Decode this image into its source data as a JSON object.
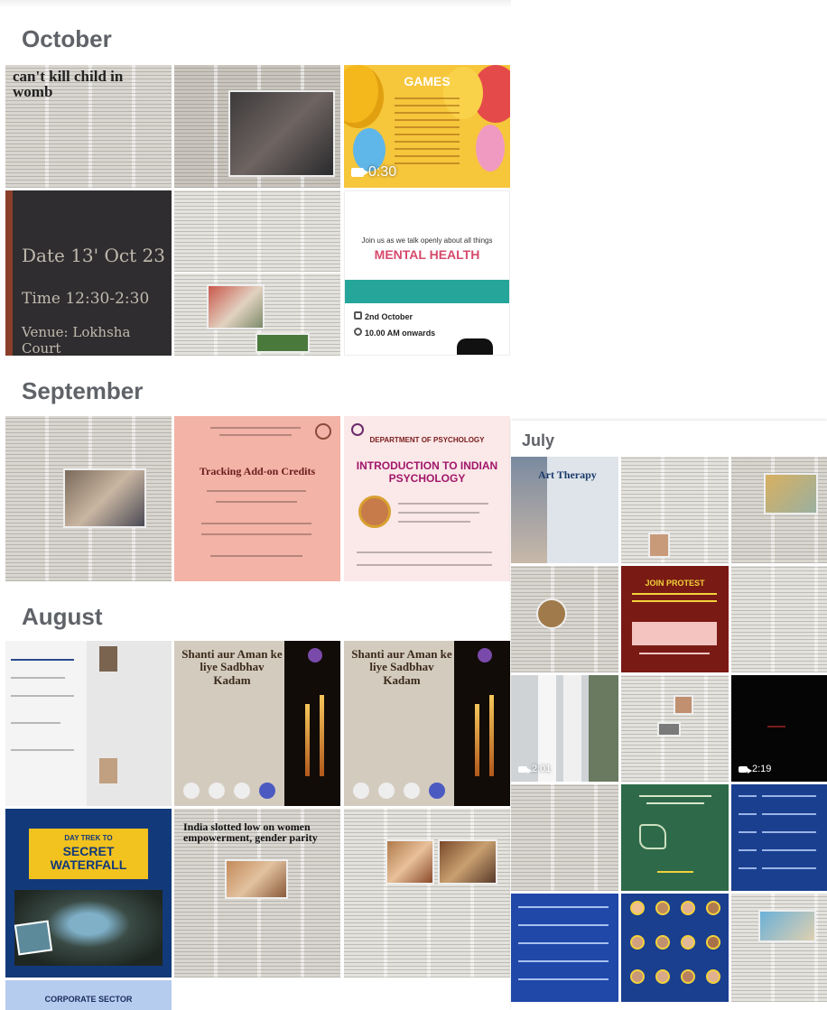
{
  "months": {
    "october": "October",
    "september": "September",
    "august": "August",
    "july": "July"
  },
  "october_tiles": {
    "newspaper_headline": "can't kill child in womb",
    "video_duration": "0:30",
    "chalkboard": {
      "line1": "Date 13' Oct 23",
      "line2": "Time 12:30-2:30",
      "line3": "Venue: Lokhsha Court"
    },
    "mental_health_poster": {
      "intro": "Join us as we talk openly about all things",
      "title": "MENTAL HEALTH",
      "date": "2nd October",
      "time": "10.00 AM onwards"
    }
  },
  "september_tiles": {
    "pink_poster_title": "Tracking Add-on Credits",
    "psychology_poster": {
      "dept": "DEPARTMENT OF PSYCHOLOGY",
      "title": "INTRODUCTION TO INDIAN PSYCHOLOGY"
    }
  },
  "august_tiles": {
    "story_title_1": "Shanti aur Aman ke liye Sadbhav Kadam",
    "story_title_2": "Shanti aur Aman ke liye Sadbhav Kadam",
    "waterfall": {
      "top": "DAY TREK TO",
      "title": "SECRET WATERFALL"
    },
    "newspaper_headline": "India slotted low on women empowerment, gender parity",
    "corporate": "CORPORATE SECTOR"
  },
  "july_tiles": {
    "art_therapy": "Art Therapy",
    "red_poster": "JOIN PROTEST",
    "video_duration_1": "2:01",
    "video_duration_2": "2:19"
  },
  "colors": {
    "month_label": "#5f6368",
    "teal": "#26a69a",
    "navy": "#1a3f8f",
    "pink": "#f3b3a6"
  }
}
